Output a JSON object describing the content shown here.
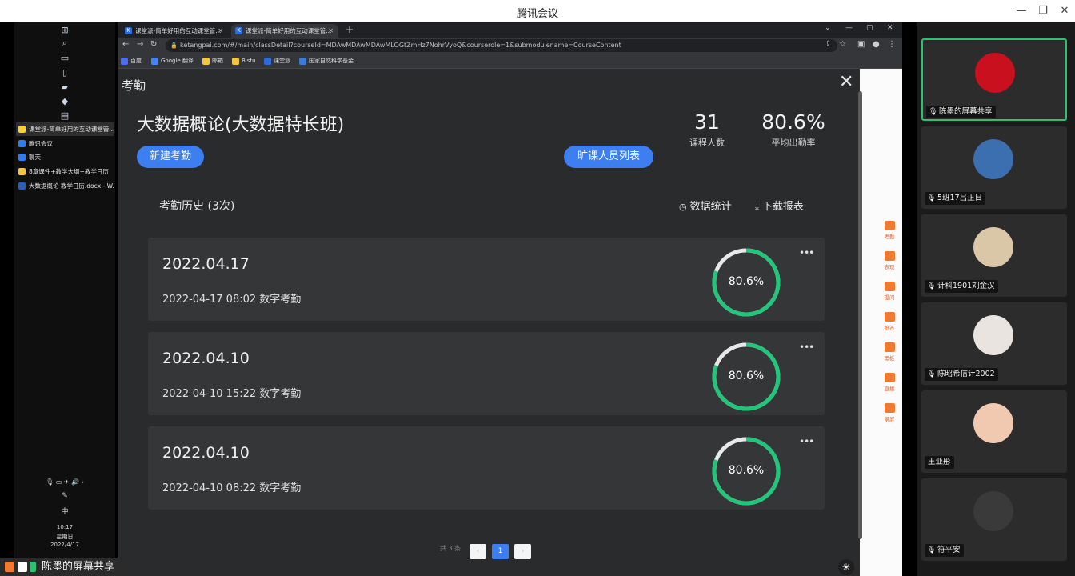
{
  "window": {
    "title": "腾讯会议",
    "minimize": "—",
    "restore": "❐",
    "close": "✕"
  },
  "taskbar": {
    "items": [
      {
        "label": "课堂派-简单好用的互动课堂管...",
        "color": "#ffcc33"
      },
      {
        "label": "腾讯会议",
        "color": "#2f7cf6"
      },
      {
        "label": "聊天",
        "color": "#2f7cf6"
      },
      {
        "label": "8章课件+教学大纲+教学日历",
        "color": "#f5c542"
      },
      {
        "label": "大数据概论 教学日历.docx - W...",
        "color": "#2b5eb8"
      }
    ],
    "tray_ime": "中",
    "time": "10:17",
    "weekday": "星期日",
    "date": "2022/4/17"
  },
  "browser": {
    "tabs": [
      {
        "label": "课堂派-简单好用的互动课堂管..."
      },
      {
        "label": "课堂派-简单好用的互动课堂管..."
      }
    ],
    "url": "ketangpai.com/#/main/classDetail?courseId=MDAwMDAwMDAwMLOGtZmHz7NohrVyoQ&courserole=1&submodulename=CourseContent",
    "bookmarks": [
      {
        "label": "百度",
        "color": "#4e6ef2"
      },
      {
        "label": "Google 翻译",
        "color": "#4285f4"
      },
      {
        "label": "邮箱",
        "color": "#f5c542"
      },
      {
        "label": "Bistu",
        "color": "#f5c542"
      },
      {
        "label": "课堂派",
        "color": "#2f6bd8"
      },
      {
        "label": "国家自然科学基金...",
        "color": "#3a7bd5"
      }
    ]
  },
  "side_tools": [
    "考勤",
    "表现",
    "提问",
    "抢答",
    "黑板",
    "直播",
    "录屏"
  ],
  "modal": {
    "title": "考勤",
    "course_name": "大数据概论(大数据特长班)",
    "stats": {
      "students": "31",
      "students_label": "课程人数",
      "rate": "80.6%",
      "rate_label": "平均出勤率"
    },
    "new_button": "新建考勤",
    "absent_button": "旷课人员列表",
    "history_title": "考勤历史 (3次)",
    "stats_action": "数据统计",
    "download_action": "下载报表",
    "records": [
      {
        "date": "2022.04.17",
        "detail": "2022-04-17 08:02 数字考勤",
        "rate": "80.6%",
        "percent": 80.6
      },
      {
        "date": "2022.04.10",
        "detail": "2022-04-10 15:22 数字考勤",
        "rate": "80.6%",
        "percent": 80.6
      },
      {
        "date": "2022.04.10",
        "detail": "2022-04-10 08:22 数字考勤",
        "rate": "80.6%",
        "percent": 80.6
      }
    ],
    "pager": {
      "total": "共 3 条",
      "prev": "‹",
      "page": "1",
      "next": "›"
    }
  },
  "presenter": {
    "label": "陈墨的屏幕共享"
  },
  "participants": [
    {
      "name": "陈墨的屏幕共享",
      "avatar": "#c8101e",
      "active": true
    },
    {
      "name": "5班17吕正日",
      "avatar": "#3b6fb0",
      "active": false
    },
    {
      "name": "计科1901刘金汉",
      "avatar": "#d9c7a8",
      "active": false
    },
    {
      "name": "陈昭希信计2002",
      "avatar": "#e9e4df",
      "active": false
    },
    {
      "name": "王亚彤",
      "avatar": "#f0c9b0",
      "active": false
    },
    {
      "name": "符平安",
      "avatar": "#3a3a3a",
      "active": false
    }
  ],
  "colors": {
    "accent": "#3d7ef0",
    "ring": "#22c67a",
    "ring_track": "#e8e8e8",
    "active_border": "#2bc46e"
  }
}
